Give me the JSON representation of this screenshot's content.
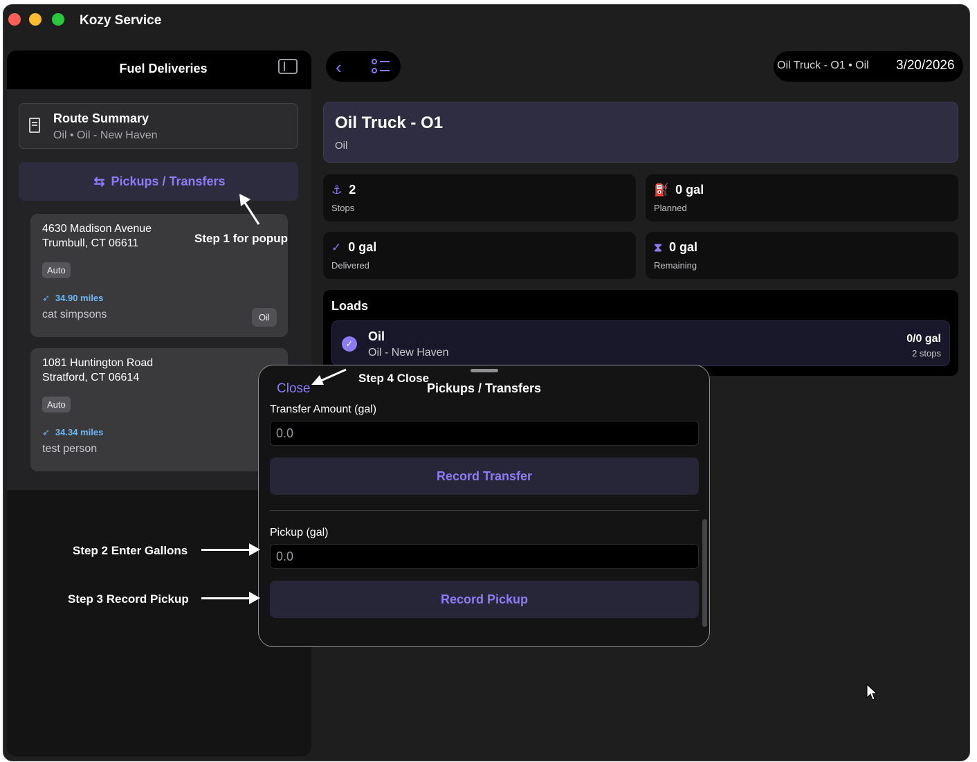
{
  "window": {
    "title": "Kozy Service"
  },
  "sidebar": {
    "title": "Fuel Deliveries",
    "route_summary": {
      "title": "Route Summary",
      "subtitle": "Oil • Oil - New Haven"
    },
    "pickups_button": "Pickups / Transfers",
    "stops": [
      {
        "address1": "4630 Madison Avenue",
        "address2": "Trumbull, CT 06611",
        "tag": "Auto",
        "miles": "34.90 miles",
        "name": "cat simpsons",
        "product": "Oil"
      },
      {
        "address1": "1081 Huntington Road",
        "address2": "Stratford, CT 06614",
        "tag": "Auto",
        "miles": "34.34 miles",
        "name": "test person"
      }
    ]
  },
  "toolbar": {
    "truck_label": "Oil Truck - O1 • Oil",
    "date": "3/20/2026"
  },
  "truck": {
    "name": "Oil Truck - O1",
    "type": "Oil"
  },
  "stats": [
    {
      "value": "2",
      "label": "Stops",
      "icon": "anchor-icon"
    },
    {
      "value": "0 gal",
      "label": "Planned",
      "icon": "fuel-pump-icon"
    },
    {
      "value": "0 gal",
      "label": "Delivered",
      "icon": "check-circle-icon"
    },
    {
      "value": "0 gal",
      "label": "Remaining",
      "icon": "hourglass-icon"
    }
  ],
  "loads": {
    "title": "Loads",
    "items": [
      {
        "name": "Oil",
        "subtitle": "Oil - New Haven",
        "amount": "0/0 gal",
        "stops": "2 stops"
      }
    ]
  },
  "sheet": {
    "close": "Close",
    "title": "Pickups / Transfers",
    "transfer_label": "Transfer Amount (gal)",
    "transfer_value": "0.0",
    "transfer_button": "Record Transfer",
    "pickup_label": "Pickup (gal)",
    "pickup_value": "0.0",
    "pickup_button": "Record Pickup"
  },
  "annotations": {
    "step1": "Step 1 for popup",
    "step2": "Step 2 Enter Gallons",
    "step3": "Step 3 Record Pickup",
    "step4": "Step 4 Close"
  },
  "colors": {
    "accent": "#8b7cf6",
    "miles": "#6ab8f7",
    "window_bg": "#1e1e1f"
  }
}
